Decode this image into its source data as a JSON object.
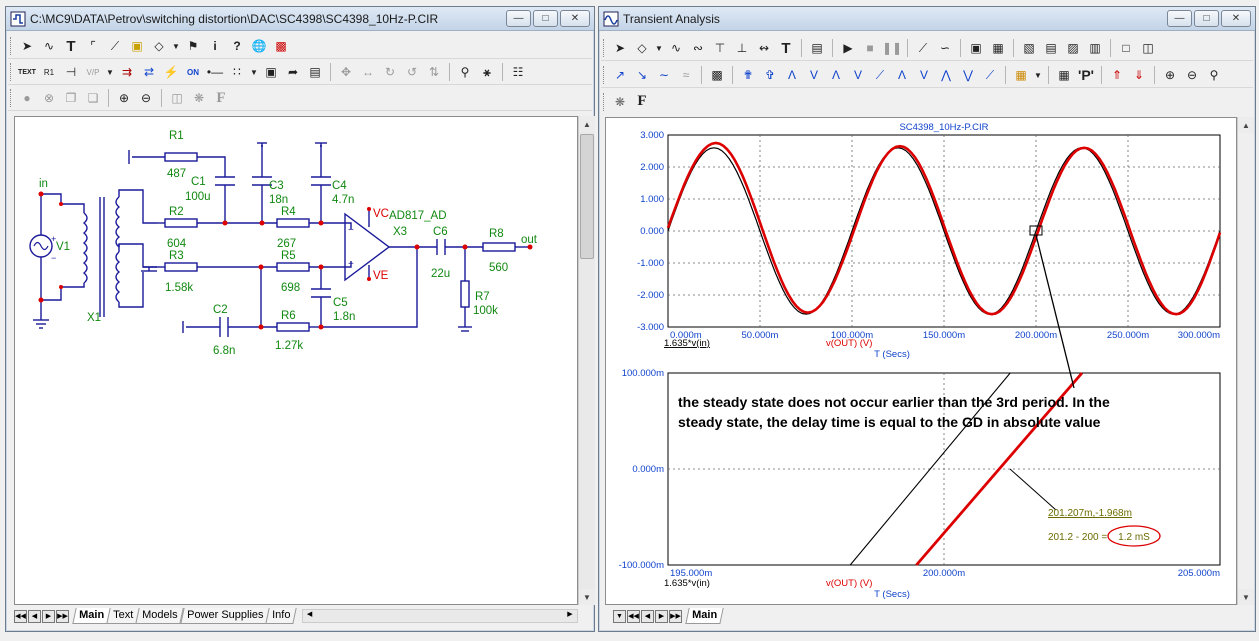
{
  "schematic": {
    "title": "C:\\MC9\\DATA\\Petrov\\switching distortion\\DAC\\SC4398\\SC4398_10Hz-P.CIR",
    "tabs": [
      "Main",
      "Text",
      "Models",
      "Power Supplies",
      "Info"
    ],
    "labels": {
      "in": "in",
      "v1": "V1",
      "x1": "X1",
      "r1": "R1",
      "r1v": "487",
      "c1": "C1",
      "c1v": "100u",
      "r2": "R2",
      "r2v": "604",
      "r3": "R3",
      "r3v": "1.58k",
      "c2": "C2",
      "c2v": "6.8n",
      "c3": "C3",
      "c3v": "18n",
      "r4": "R4",
      "r4v": "267",
      "r5": "R5",
      "r5v": "698",
      "r6": "R6",
      "r6v": "1.27k",
      "c4": "C4",
      "c4v": "4.7n",
      "c5": "C5",
      "c5v": "1.8n",
      "vc": "VC",
      "ve": "VE",
      "opamp": "AD817_AD",
      "x3": "X3",
      "c6": "C6",
      "c6v": "22u",
      "r7": "R7",
      "r7v": "100k",
      "r8": "R8",
      "r8v": "560",
      "out": "out"
    }
  },
  "transient": {
    "title": "Transient Analysis",
    "tabs": [
      "Main"
    ],
    "top_plot": {
      "title": "SC4398_10Hz-P.CIR",
      "yticks": [
        "3.000",
        "2.000",
        "1.000",
        "0.000",
        "-1.000",
        "-2.000",
        "-3.000"
      ],
      "xticks": [
        "0.000m",
        "50.000m",
        "100.000m",
        "150.000m",
        "200.000m",
        "250.000m",
        "300.000m"
      ],
      "trace1_label": "1.635*v(in)",
      "trace2_label": "v(OUT) (V)",
      "xlabel": "T (Secs)"
    },
    "bottom_plot": {
      "yticks": [
        "100.000m",
        "0.000m",
        "-100.000m"
      ],
      "xticks": [
        "195.000m",
        "200.000m",
        "205.000m"
      ],
      "trace1_label": "1.635*v(in)",
      "trace2_label": "v(OUT) (V)",
      "xlabel": "T (Secs)",
      "cursor_readout": "201.207m,-1.968m",
      "delay_prefix": "201.2 - 200 =",
      "delay_value": "1.2 mS"
    },
    "annotation_line1": "the steady state does not occur earlier than the 3rd period. In the",
    "annotation_line2": "steady state, the delay time is equal to the GD in absolute value"
  },
  "chart_data": [
    {
      "type": "line",
      "title": "SC4398_10Hz-P.CIR",
      "xlabel": "T (Secs)",
      "ylabel": "",
      "xlim": [
        0,
        0.3
      ],
      "ylim": [
        -3,
        3
      ],
      "grid": true,
      "series": [
        {
          "name": "1.635*v(in)",
          "color": "#000000",
          "x": [
            0,
            0.025,
            0.05,
            0.075,
            0.1,
            0.125,
            0.15,
            0.175,
            0.2,
            0.225,
            0.25,
            0.275,
            0.3
          ],
          "y": [
            0,
            2.6,
            0,
            -2.6,
            0,
            2.6,
            0,
            -2.6,
            0,
            2.6,
            0,
            -2.6,
            0
          ]
        },
        {
          "name": "v(OUT) (V)",
          "color": "#dd0000",
          "x": [
            0,
            0.026,
            0.051,
            0.076,
            0.101,
            0.126,
            0.151,
            0.176,
            0.2012,
            0.2262,
            0.2512,
            0.2762,
            0.3
          ],
          "y": [
            0.1,
            2.75,
            0.1,
            -2.55,
            0,
            2.65,
            0,
            -2.6,
            0,
            2.6,
            0,
            -2.6,
            -0.05
          ]
        }
      ]
    },
    {
      "type": "line",
      "xlabel": "T (Secs)",
      "ylabel": "",
      "xlim": [
        0.195,
        0.205
      ],
      "ylim": [
        -0.1,
        0.1
      ],
      "grid": true,
      "series": [
        {
          "name": "1.635*v(in)",
          "color": "#000000",
          "x": [
            0.1983,
            0.2012
          ],
          "y": [
            -0.1,
            0.1
          ]
        },
        {
          "name": "v(OUT) (V)",
          "color": "#dd0000",
          "x": [
            0.1995,
            0.2025
          ],
          "y": [
            -0.1,
            0.1
          ]
        }
      ]
    }
  ]
}
